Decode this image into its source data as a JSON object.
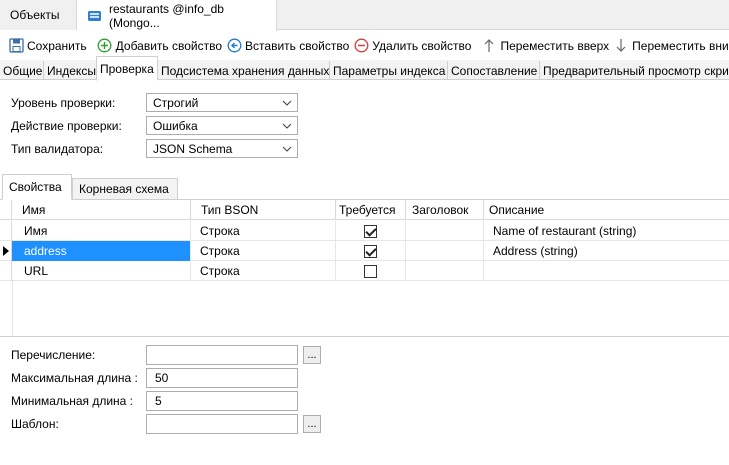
{
  "doc_tabs": {
    "objects": "Объекты",
    "active": "restaurants @info_db (Mongo..."
  },
  "toolbar": {
    "save": "Сохранить",
    "add_property": "Добавить свойство",
    "insert_property": "Вставить свойство",
    "delete_property": "Удалить свойство",
    "move_up": "Переместить вверх",
    "move_down": "Переместить вниз"
  },
  "prop_tabs": [
    "Общие",
    "Индексы",
    "Проверка",
    "Подсистема хранения данных",
    "Параметры индекса",
    "Сопоставление",
    "Предварительный просмотр скрипта"
  ],
  "validation": {
    "level_label": "Уровень проверки:",
    "level_value": "Строгий",
    "action_label": "Действие проверки:",
    "action_value": "Ошибка",
    "validator_label": "Тип валидатора:",
    "validator_value": "JSON Schema"
  },
  "sub_tabs": {
    "properties": "Свойства",
    "root_schema": "Корневая схема"
  },
  "grid": {
    "headers": [
      "Имя",
      "Тип BSON",
      "Требуется",
      "Заголовок",
      "Описание"
    ],
    "rows": [
      {
        "name": "Имя",
        "type": "Строка",
        "required": true,
        "title": "",
        "description": "Name of restaurant (string)"
      },
      {
        "name": "address",
        "type": "Строка",
        "required": true,
        "title": "",
        "description": "Address (string)"
      },
      {
        "name": "URL",
        "type": "Строка",
        "required": false,
        "title": "",
        "description": ""
      }
    ]
  },
  "details": {
    "enum_label": "Перечисление:",
    "enum_value": "",
    "max_len_label": "Максимальная длина :",
    "max_len_value": "50",
    "min_len_label": "Минимальная длина :",
    "min_len_value": "5",
    "pattern_label": "Шаблон:",
    "pattern_value": "",
    "ellipsis": "..."
  }
}
